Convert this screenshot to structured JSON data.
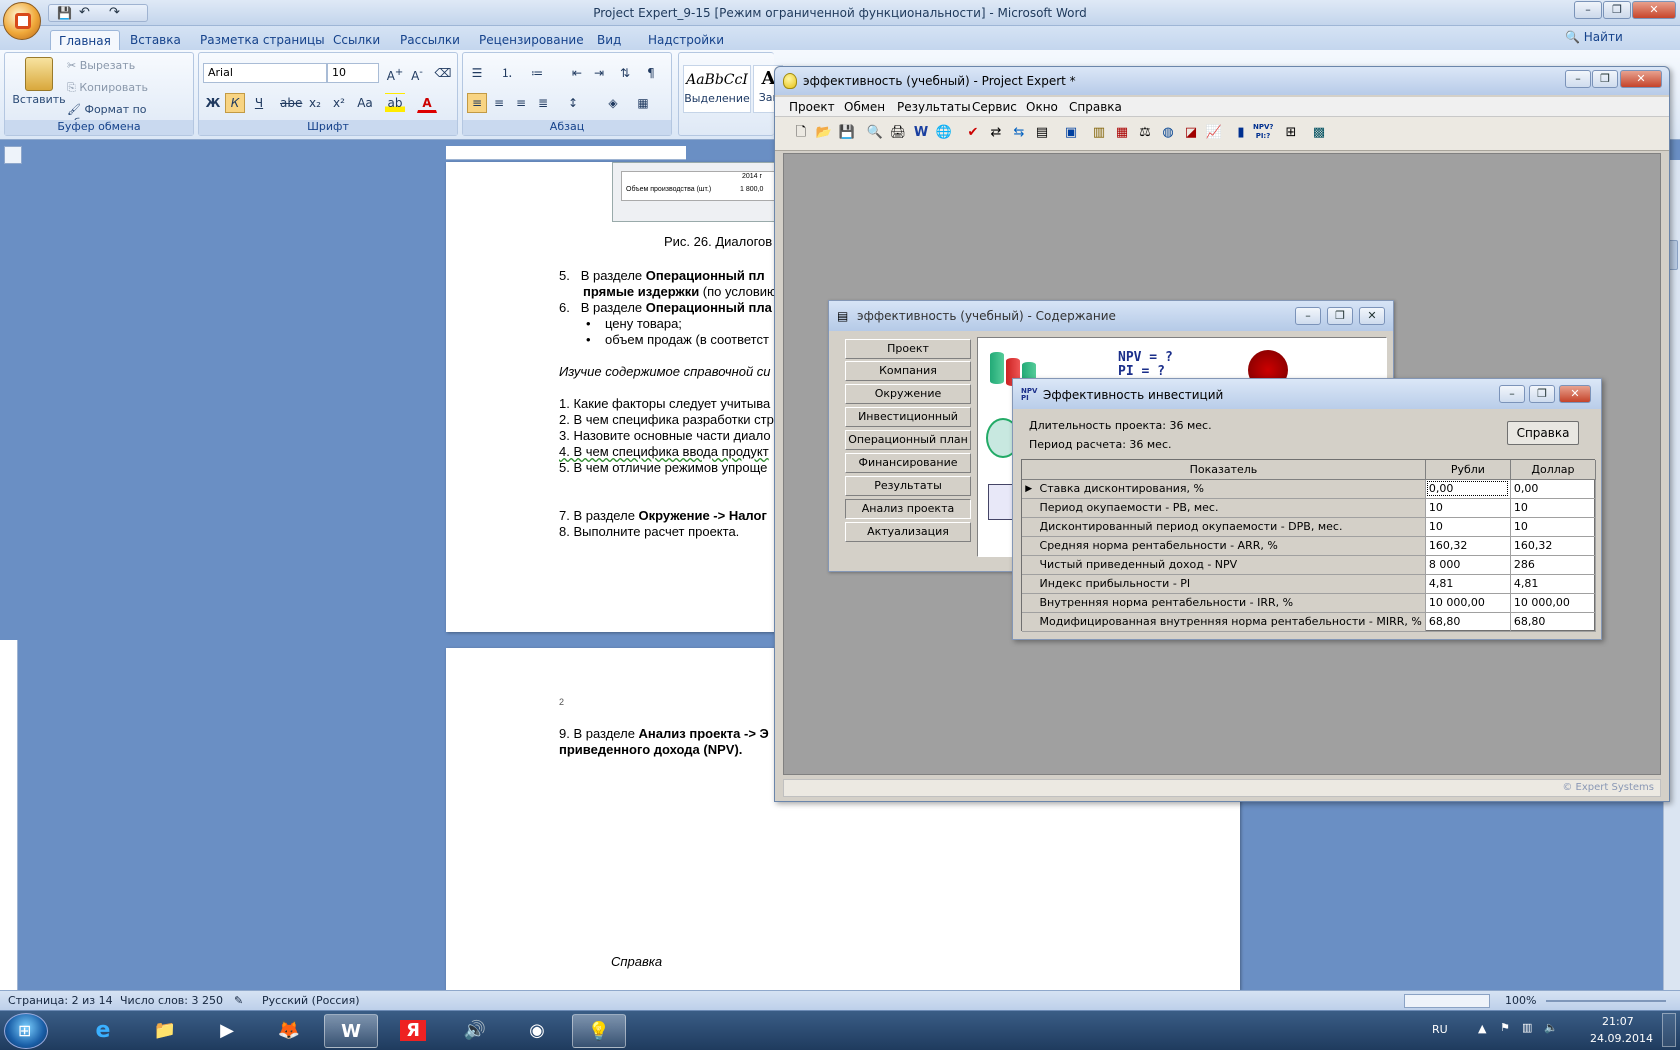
{
  "word": {
    "title": "Project Expert_9-15 [Режим ограниченной функциональности] - Microsoft Word",
    "tabs": [
      "Главная",
      "Вставка",
      "Разметка страницы",
      "Ссылки",
      "Рассылки",
      "Рецензирование",
      "Вид",
      "Надстройки"
    ],
    "ribbon": {
      "clipboard": {
        "paste": "Вставить",
        "cut": "Вырезать",
        "copy": "Копировать",
        "format_painter": "Формат по образцу",
        "label": "Буфер обмена"
      },
      "font": {
        "name": "Arial",
        "size": "10",
        "label": "Шрифт",
        "bold": "Ж",
        "italic": "К",
        "underline": "Ч",
        "strike": "abe",
        "subscript": "x₂",
        "superscript": "x²",
        "case": "Aa"
      },
      "paragraph": {
        "label": "Абзац"
      },
      "styles": {
        "style1_sample": "AaBbCcI",
        "style1_name": "Выделение",
        "style2_sample": "A",
        "style2_name": "Заг"
      },
      "find": "Найти"
    },
    "doc": {
      "page1": {
        "figure_row_label": "Объем производства (шт.)",
        "figure_col": "2014 г",
        "figure_val": "1 800,0",
        "caption": "Рис. 26. Диалогов",
        "items": [
          {
            "num": "5.",
            "pre": "В разделе ",
            "bold": "Операционный пл",
            "rest": ""
          },
          {
            "num": "",
            "pre": "",
            "bold": "прямые издержки",
            "rest": " (по условию"
          },
          {
            "num": "6.",
            "pre": "В разделе ",
            "bold": "Операционный пла",
            "rest": ""
          }
        ],
        "bullets": [
          "цену товара;",
          "объем продаж (в соответст"
        ],
        "italic_line": "Изучие содержимое справочной си",
        "questions": [
          "1. Какие факторы следует учитыва",
          "2. В чем специфика разработки стр",
          "3. Назовите основные части диало",
          "4. В чем специфика ввода продукт",
          "5. В чем отличие режимов упроще"
        ],
        "item7_pre": "7. В разделе ",
        "item7_bold": "Окружение -> Налог",
        "item8": "8. Выполните расчет проекта."
      },
      "page2": {
        "page_number": "2",
        "item9_pre": "9. В разделе ",
        "item9_bold": "Анализ проекта -> Э",
        "item9_line2": "приведенного дохода (NPV).",
        "help": "Справка"
      }
    },
    "status": {
      "page": "Страница: 2 из 14",
      "words": "Число слов: 3 250",
      "lang": "Русский (Россия)",
      "zoom": "100%"
    }
  },
  "pe": {
    "title": "эффективность (учебный) - Project Expert *",
    "menu": [
      "Проект",
      "Обмен",
      "Результаты",
      "Сервис",
      "Окно",
      "Справка"
    ],
    "status_brand": "© Expert Systems",
    "contents": {
      "title": "эффективность (учебный) - Содержание",
      "nav": [
        "Проект",
        "Компания",
        "Окружение",
        "Инвестиционный план",
        "Операционный план",
        "Финансирование",
        "Результаты",
        "Анализ проекта",
        "Актуализация"
      ],
      "npv_label": "NPV = ?",
      "pi_label": "PI = ?"
    },
    "efficiency": {
      "title": "Эффективность инвестиций",
      "duration": "Длительность проекта: 36 мес.",
      "period": "Период расчета: 36 мес.",
      "help_button": "Справка",
      "columns": [
        "Показатель",
        "Рубли",
        "Доллар"
      ],
      "rows": [
        {
          "name": "Ставка дисконтирования, %",
          "rub": "0,00",
          "usd": "0,00"
        },
        {
          "name": "Период окупаемости - PB, мес.",
          "rub": "10",
          "usd": "10"
        },
        {
          "name": "Дисконтированный период окупаемости - DPB, мес.",
          "rub": "10",
          "usd": "10"
        },
        {
          "name": "Средняя норма рентабельности - ARR, %",
          "rub": "160,32",
          "usd": "160,32"
        },
        {
          "name": "Чистый приведенный доход - NPV",
          "rub": "8 000",
          "usd": "286"
        },
        {
          "name": "Индекс прибыльности - PI",
          "rub": "4,81",
          "usd": "4,81"
        },
        {
          "name": "Внутренняя норма рентабельности - IRR, %",
          "rub": "10 000,00",
          "usd": "10 000,00"
        },
        {
          "name": "Модифицированная внутренняя норма рентабельности - MIRR, %",
          "rub": "68,80",
          "usd": "68,80"
        }
      ]
    }
  },
  "taskbar": {
    "lang": "RU",
    "time": "21:07",
    "date": "24.09.2014"
  }
}
